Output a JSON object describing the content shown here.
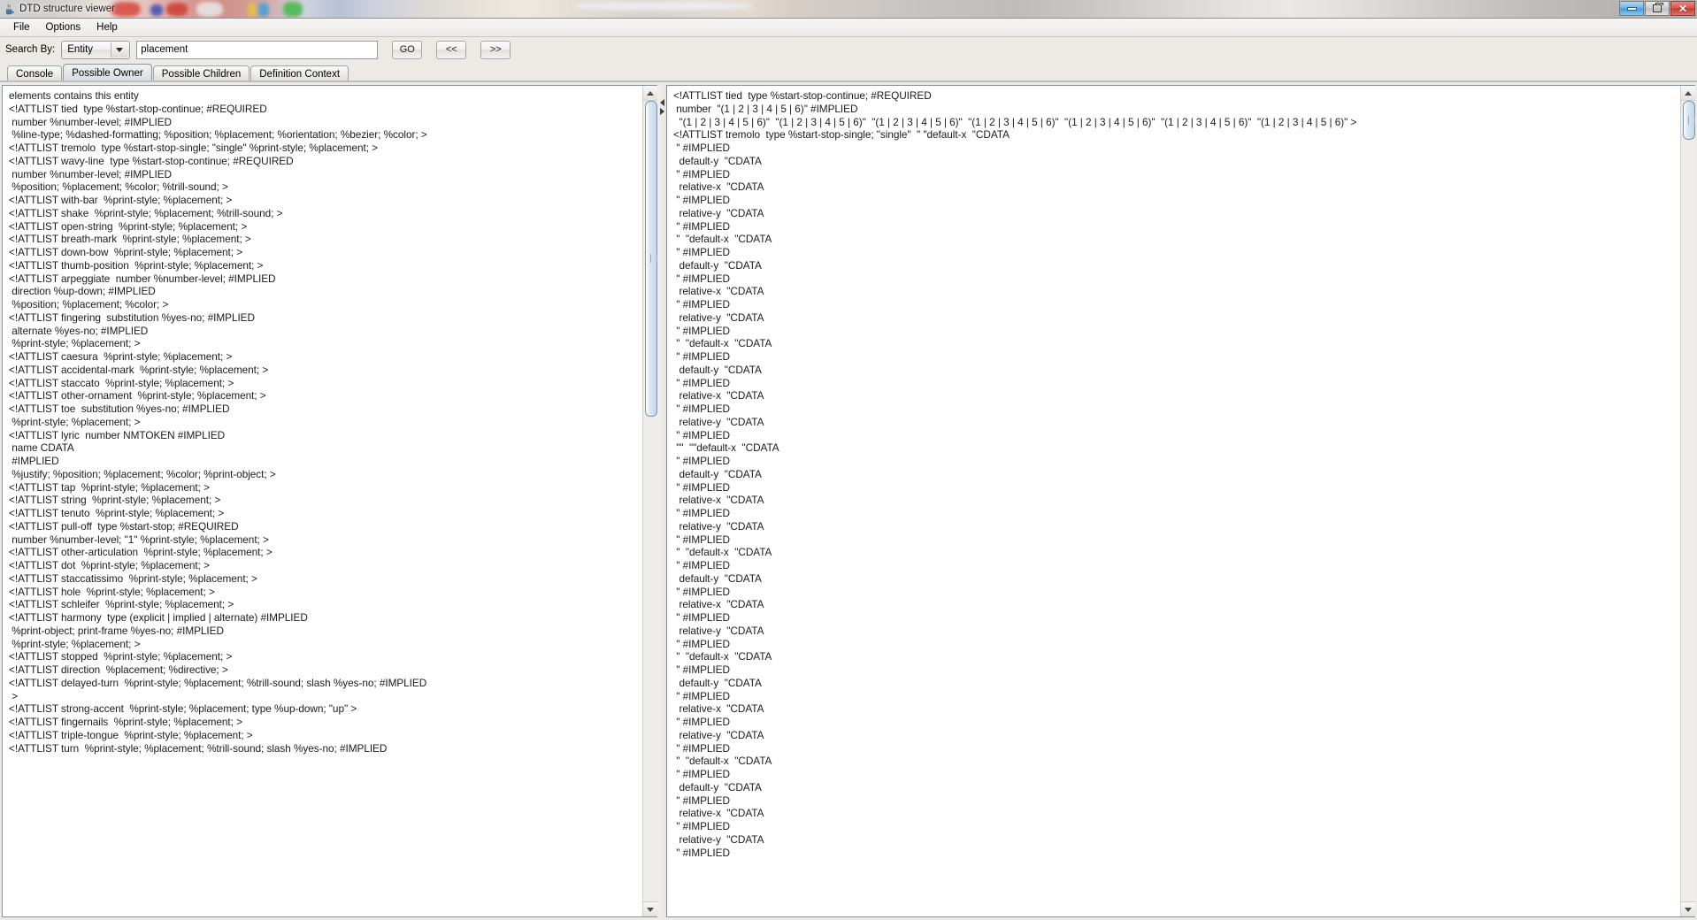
{
  "window": {
    "title": "DTD structure viewer",
    "icon": "java-coffee-cup-icon",
    "controls": {
      "minimize": "minimize-icon",
      "maximize": "maximize-icon",
      "close": "close-icon"
    }
  },
  "menubar": {
    "items": [
      {
        "label": "File"
      },
      {
        "label": "Options"
      },
      {
        "label": "Help"
      }
    ]
  },
  "search": {
    "label": "Search By:",
    "combo_value": "Entity",
    "combo_options": [
      "Entity"
    ],
    "input_value": "placement",
    "input_placeholder": "",
    "go_label": "GO",
    "prev_label": "<<",
    "next_label": ">>"
  },
  "tabs": [
    {
      "label": "Console",
      "selected": false
    },
    {
      "label": "Possible Owner",
      "selected": true
    },
    {
      "label": "Possible Children",
      "selected": false
    },
    {
      "label": "Definition Context",
      "selected": false
    }
  ],
  "left_panel": {
    "lines": [
      "elements contains this entity",
      "<!ATTLIST tied  type %start-stop-continue; #REQUIRED",
      " number %number-level; #IMPLIED",
      " %line-type; %dashed-formatting; %position; %placement; %orientation; %bezier; %color; >",
      "<!ATTLIST tremolo  type %start-stop-single; \"single\" %print-style; %placement; >",
      "<!ATTLIST wavy-line  type %start-stop-continue; #REQUIRED",
      " number %number-level; #IMPLIED",
      " %position; %placement; %color; %trill-sound; >",
      "<!ATTLIST with-bar  %print-style; %placement; >",
      "<!ATTLIST shake  %print-style; %placement; %trill-sound; >",
      "<!ATTLIST open-string  %print-style; %placement; >",
      "<!ATTLIST breath-mark  %print-style; %placement; >",
      "<!ATTLIST down-bow  %print-style; %placement; >",
      "<!ATTLIST thumb-position  %print-style; %placement; >",
      "<!ATTLIST arpeggiate  number %number-level; #IMPLIED",
      " direction %up-down; #IMPLIED",
      " %position; %placement; %color; >",
      "<!ATTLIST fingering  substitution %yes-no; #IMPLIED",
      " alternate %yes-no; #IMPLIED",
      " %print-style; %placement; >",
      "<!ATTLIST caesura  %print-style; %placement; >",
      "<!ATTLIST accidental-mark  %print-style; %placement; >",
      "<!ATTLIST staccato  %print-style; %placement; >",
      "<!ATTLIST other-ornament  %print-style; %placement; >",
      "<!ATTLIST toe  substitution %yes-no; #IMPLIED",
      " %print-style; %placement; >",
      "<!ATTLIST lyric  number NMTOKEN #IMPLIED",
      " name CDATA",
      " #IMPLIED",
      " %justify; %position; %placement; %color; %print-object; >",
      "<!ATTLIST tap  %print-style; %placement; >",
      "<!ATTLIST string  %print-style; %placement; >",
      "<!ATTLIST tenuto  %print-style; %placement; >",
      "<!ATTLIST pull-off  type %start-stop; #REQUIRED",
      " number %number-level; \"1\" %print-style; %placement; >",
      "<!ATTLIST other-articulation  %print-style; %placement; >",
      "<!ATTLIST dot  %print-style; %placement; >",
      "<!ATTLIST staccatissimo  %print-style; %placement; >",
      "<!ATTLIST hole  %print-style; %placement; >",
      "<!ATTLIST schleifer  %print-style; %placement; >",
      "<!ATTLIST harmony  type (explicit | implied | alternate) #IMPLIED",
      " %print-object; print-frame %yes-no; #IMPLIED",
      " %print-style; %placement; >",
      "<!ATTLIST stopped  %print-style; %placement; >",
      "<!ATTLIST direction  %placement; %directive; >",
      "<!ATTLIST delayed-turn  %print-style; %placement; %trill-sound; slash %yes-no; #IMPLIED",
      " >",
      "<!ATTLIST strong-accent  %print-style; %placement; type %up-down; \"up\" >",
      "<!ATTLIST fingernails  %print-style; %placement; >",
      "<!ATTLIST triple-tongue  %print-style; %placement; >",
      "<!ATTLIST turn  %print-style; %placement; %trill-sound; slash %yes-no; #IMPLIED"
    ]
  },
  "right_panel": {
    "lines": [
      "<!ATTLIST tied  type %start-stop-continue; #REQUIRED",
      " number  \"(1 | 2 | 3 | 4 | 5 | 6)\" #IMPLIED",
      "  \"(1 | 2 | 3 | 4 | 5 | 6)\"  \"(1 | 2 | 3 | 4 | 5 | 6)\"  \"(1 | 2 | 3 | 4 | 5 | 6)\"  \"(1 | 2 | 3 | 4 | 5 | 6)\"  \"(1 | 2 | 3 | 4 | 5 | 6)\"  \"(1 | 2 | 3 | 4 | 5 | 6)\"  \"(1 | 2 | 3 | 4 | 5 | 6)\" >",
      "<!ATTLIST tremolo  type %start-stop-single; \"single\"  \" \"default-x  \"CDATA",
      " \" #IMPLIED",
      "  default-y  \"CDATA",
      " \" #IMPLIED",
      "  relative-x  \"CDATA",
      " \" #IMPLIED",
      "  relative-y  \"CDATA",
      " \" #IMPLIED",
      " \"  \"default-x  \"CDATA",
      " \" #IMPLIED",
      "  default-y  \"CDATA",
      " \" #IMPLIED",
      "  relative-x  \"CDATA",
      " \" #IMPLIED",
      "  relative-y  \"CDATA",
      " \" #IMPLIED",
      " \"  \"default-x  \"CDATA",
      " \" #IMPLIED",
      "  default-y  \"CDATA",
      " \" #IMPLIED",
      "  relative-x  \"CDATA",
      " \" #IMPLIED",
      "  relative-y  \"CDATA",
      " \" #IMPLIED",
      " \"\"  \"\"default-x  \"CDATA",
      " \" #IMPLIED",
      "  default-y  \"CDATA",
      " \" #IMPLIED",
      "  relative-x  \"CDATA",
      " \" #IMPLIED",
      "  relative-y  \"CDATA",
      " \" #IMPLIED",
      " \"  \"default-x  \"CDATA",
      " \" #IMPLIED",
      "  default-y  \"CDATA",
      " \" #IMPLIED",
      "  relative-x  \"CDATA",
      " \" #IMPLIED",
      "  relative-y  \"CDATA",
      " \" #IMPLIED",
      " \"  \"default-x  \"CDATA",
      " \" #IMPLIED",
      "  default-y  \"CDATA",
      " \" #IMPLIED",
      "  relative-x  \"CDATA",
      " \" #IMPLIED",
      "  relative-y  \"CDATA",
      " \" #IMPLIED",
      " \"  \"default-x  \"CDATA",
      " \" #IMPLIED",
      "  default-y  \"CDATA",
      " \" #IMPLIED",
      "  relative-x  \"CDATA",
      " \" #IMPLIED",
      "  relative-y  \"CDATA",
      " \" #IMPLIED"
    ]
  },
  "scrollbars": {
    "left": {
      "up": "scroll-up-icon",
      "down": "scroll-down-icon"
    },
    "right": {
      "up": "scroll-up-icon",
      "down": "scroll-down-icon"
    }
  },
  "splitter": {
    "collapse_left": "splitter-left-arrow-icon",
    "collapse_right": "splitter-right-arrow-icon"
  }
}
